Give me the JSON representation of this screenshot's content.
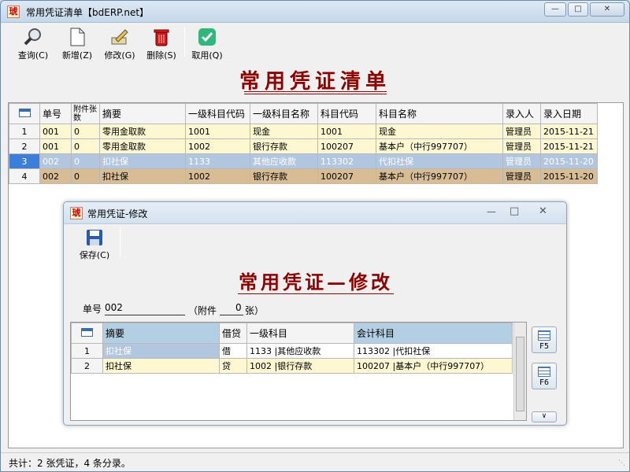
{
  "window": {
    "title": "常用凭证清单【bdERP.net】",
    "icon_char": "琥"
  },
  "toolbar": [
    {
      "label": "查询(C)",
      "icon": "magnifier-icon"
    },
    {
      "label": "新增(Z)",
      "icon": "new-document-icon"
    },
    {
      "label": "修改(G)",
      "icon": "edit-pencil-icon"
    },
    {
      "label": "删除(S)",
      "icon": "trash-icon"
    },
    {
      "label": "取用(Q)",
      "icon": "check-icon"
    }
  ],
  "main_title": "常用凭证清单",
  "list": {
    "headers": [
      "单号",
      "附件张数",
      "摘要",
      "一级科目代码",
      "一级科目名称",
      "科目代码",
      "科目名称",
      "录入人",
      "录入日期"
    ],
    "rows": [
      {
        "n": "1",
        "cells": [
          "001",
          "0",
          "零用金取款",
          "1001",
          "现金",
          "1001",
          "现金",
          "管理员",
          "2015-11-21"
        ]
      },
      {
        "n": "2",
        "cells": [
          "001",
          "0",
          "零用金取款",
          "1002",
          "银行存款",
          "100207",
          "基本户（中行997707）",
          "管理员",
          "2015-11-21"
        ]
      },
      {
        "n": "3",
        "cells": [
          "002",
          "0",
          "扣社保",
          "1133",
          "其他应收款",
          "113302",
          "代扣社保",
          "管理员",
          "2015-11-20"
        ]
      },
      {
        "n": "4",
        "cells": [
          "002",
          "0",
          "扣社保",
          "1002",
          "银行存款",
          "100207",
          "基本户（中行997707）",
          "管理员",
          "2015-11-20"
        ]
      }
    ]
  },
  "dialog": {
    "title": "常用凭证-修改",
    "save_label": "保存(C)",
    "heading": "常用凭证—修改",
    "order_label": "单号",
    "order_value": "002",
    "attach_prefix": "（附件",
    "attach_value": "0",
    "attach_suffix": "张）",
    "grid_headers": [
      "摘要",
      "借贷",
      "一级科目",
      "会计科目"
    ],
    "grid_rows": [
      {
        "n": "1",
        "cells": [
          "扣社保",
          "借",
          "1133 |其他应收款",
          "113302 |代扣社保"
        ]
      },
      {
        "n": "2",
        "cells": [
          "扣社保",
          "贷",
          "1002 |银行存款",
          "100207 |基本户（中行997707）"
        ]
      }
    ],
    "f5": "F5",
    "f6": "F6"
  },
  "status": "共计：2 张凭证，4 条分录。",
  "colors": {
    "title_red": "#8b0000",
    "row_yellow": "#fdf8d2",
    "row_selected": "#b2c6e0",
    "row_tan": "#d8bc94"
  }
}
